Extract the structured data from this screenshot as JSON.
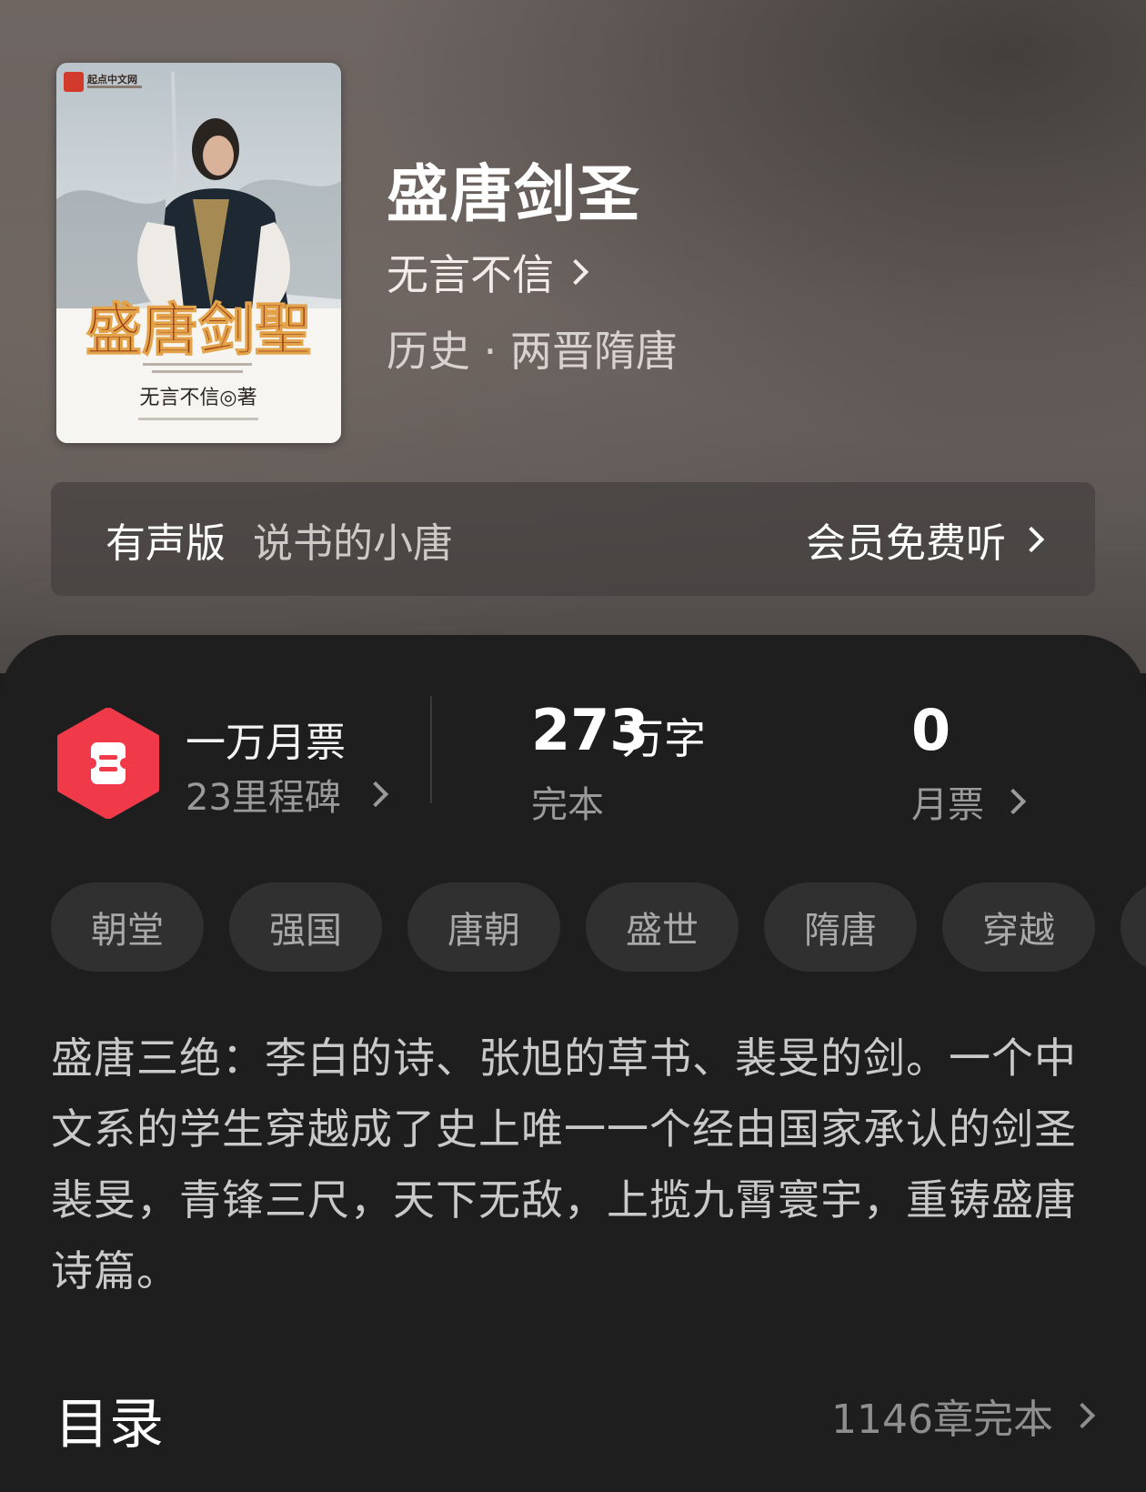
{
  "book": {
    "title": "盛唐剑圣",
    "author": "无言不信",
    "genre": "历史 · 两晋隋唐",
    "cover": {
      "publisher_badge": "起点中文网",
      "title_calligraphy": "盛唐剑聖",
      "author_line": "无言不信◎著"
    }
  },
  "audio": {
    "label": "有声版",
    "narrator": "说书的小唐",
    "cta": "会员免费听"
  },
  "stats": {
    "ticket_title": "一万月票",
    "ticket_sub": "23里程碑",
    "word_count_num": "273",
    "word_count_unit": "万字",
    "status": "完本",
    "monthly_votes": "0",
    "monthly_votes_label": "月票"
  },
  "tags": [
    "朝堂",
    "强国",
    "唐朝",
    "盛世",
    "隋唐",
    "穿越"
  ],
  "description": "盛唐三绝：李白的诗、张旭的草书、裴旻的剑。一个中文系的学生穿越成了史上唯一一个经由国家承认的剑圣裴旻，青锋三尺，天下无敌，上揽九霄寰宇，重铸盛唐诗篇。",
  "toc": {
    "title": "目录",
    "meta": "1146章完本"
  },
  "colors": {
    "badge_red": "#f03a4a",
    "panel_bg": "#1f1e1e",
    "tag_bg": "#313030"
  }
}
